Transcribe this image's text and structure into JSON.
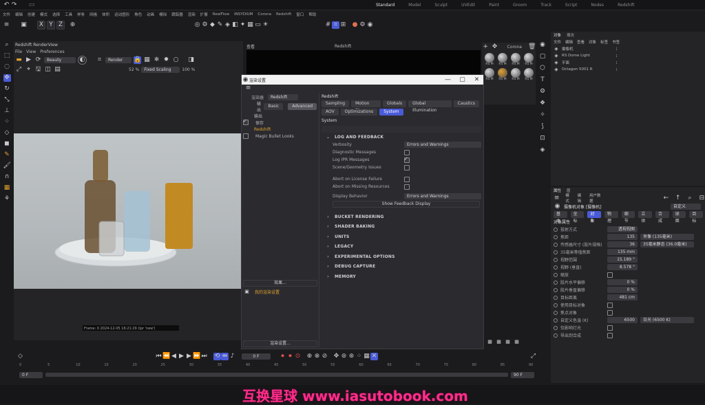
{
  "top_modes": [
    "Standard",
    "Model",
    "Sculpt",
    "UVEdit",
    "Paint",
    "Groom",
    "Track",
    "Script",
    "Nodes",
    "Redshift"
  ],
  "top_modes_active": 0,
  "menubar": [
    "文件",
    "编辑",
    "创建",
    "模式",
    "选择",
    "工具",
    "样条",
    "网格",
    "体积",
    "运动图形",
    "角色",
    "动画",
    "模拟",
    "跟踪器",
    "渲染",
    "扩展",
    "RealFlow",
    "INSYDIUM",
    "Corona",
    "Redshift",
    "窗口",
    "帮助"
  ],
  "xyz": [
    "X",
    "Y",
    "Z"
  ],
  "render_view": {
    "title": "Redshift RenderView",
    "menu": [
      "File",
      "View",
      "Preferences"
    ],
    "camera_dd": "Beauty",
    "render_dd": "Render",
    "zoom": "52 %",
    "fit_dd": "Fixed Scaling",
    "scale": "100 %",
    "status": "Frame: 0  2024-12-05 16:21:29  (Ipr 'new')"
  },
  "viewport_header": {
    "view_label": "查看",
    "title": "Redshift"
  },
  "material_panel": {
    "title": "Corona",
    "mats": [
      "RS M",
      "RS M",
      "RS M",
      "RS M",
      "RS M",
      "RS M",
      "RS M",
      "RS M"
    ]
  },
  "dialog": {
    "title": "渲染设置",
    "renderer_label": "渲染器",
    "renderer": "Redshift",
    "left_tabs": [
      "输出",
      "Basic",
      "Advanced"
    ],
    "left_tree": [
      "输出",
      "保存",
      "Redshift",
      "Magic Bullet Looks"
    ],
    "renderer_title": "Redshift",
    "tabs_row1": [
      "Sampling",
      "Motion Blur",
      "Globals",
      "Global Illumination",
      "Caustics"
    ],
    "tabs_row2": [
      "AOV",
      "Optimizations",
      "System"
    ],
    "active_tab": "System",
    "panel_title": "System",
    "log_section": "LOG AND FEEDBACK",
    "verbosity_label": "Verbosity",
    "verbosity_value": "Errors and Warnings",
    "diag_label": "Diagnostic Messages",
    "log_ipr_label": "Log IPR Messages",
    "scene_issues_label": "Scene/Geometry Issues",
    "abort_license_label": "Abort on License Failure",
    "abort_missing_label": "Abort on Missing Resources",
    "display_label": "Display Behavior",
    "display_value": "Errors and Warnings",
    "show_feedback_btn": "Show Feedback Display",
    "sections": [
      "BUCKET RENDERING",
      "SHADER BAKING",
      "UNITS",
      "LEGACY",
      "EXPERIMENTAL OPTIONS",
      "DEBUG CAPTURE",
      "MEMORY"
    ],
    "effect_btn": "效果...",
    "my_render_setting": "我的渲染设置",
    "render_setting_btn": "渲染设置..."
  },
  "objects_panel": {
    "tabs": [
      "对象",
      "场次"
    ],
    "menu": [
      "文件",
      "编辑",
      "查看",
      "对象",
      "标签",
      "书签"
    ],
    "items": [
      "摄像机",
      "RS Dome Light",
      "平面",
      "Octagon 5001 R"
    ]
  },
  "attributes_panel": {
    "tabs": [
      "属性",
      "层"
    ],
    "menu": [
      "模式",
      "编辑",
      "用户数据"
    ],
    "object_title": "摄像机对象 [摄像机]",
    "preset": "自定义",
    "sub_tabs": [
      "基本",
      "坐标",
      "对象",
      "物理",
      "细节",
      "立体",
      "合成",
      "球面",
      "目标"
    ],
    "section": "对象属性",
    "rows": [
      {
        "label": "投射方式",
        "value": "透视视图"
      },
      {
        "label": "焦距",
        "value": "135",
        "dd": "肖像 (135毫米)"
      },
      {
        "label": "传感器尺寸 (胶片规格)",
        "value": "36",
        "dd": "35毫米静态 (36.0毫米)"
      },
      {
        "label": "35毫米等值焦距",
        "value": "135 mm"
      },
      {
        "label": "视野范围",
        "value": "15.189 °"
      },
      {
        "label": "视野 (垂直)",
        "value": "8.578 °"
      },
      {
        "label": "缩放",
        "value": ""
      },
      {
        "label": "胶片水平偏移",
        "value": "0 %"
      },
      {
        "label": "胶片垂直偏移",
        "value": "0 %"
      },
      {
        "label": "目标距离",
        "value": "481 cm"
      },
      {
        "label": "使用目标对象",
        "value": ""
      },
      {
        "label": "焦点对象",
        "value": ""
      },
      {
        "label": "自定义色温 (K)",
        "value": "6500",
        "dd": "日光 (6500 K)"
      },
      {
        "label": "仅影响灯光",
        "value": ""
      },
      {
        "label": "导出到合成",
        "value": ""
      }
    ]
  },
  "timeline": {
    "start": "0 F",
    "end": "90 F",
    "current": "0 F",
    "ticks": [
      "0",
      "5",
      "10",
      "15",
      "20",
      "25",
      "30",
      "35",
      "40",
      "45",
      "50",
      "55",
      "60",
      "65",
      "70",
      "75",
      "80",
      "85",
      "90"
    ]
  },
  "watermark": "互换星球 www.iasutobook.com",
  "colors": {
    "accent": "#4a5bd8",
    "bg": "#1b1b1d",
    "panel": "#26262a",
    "dialog": "#2b2b2f",
    "watermark": "#ff2e8a"
  }
}
